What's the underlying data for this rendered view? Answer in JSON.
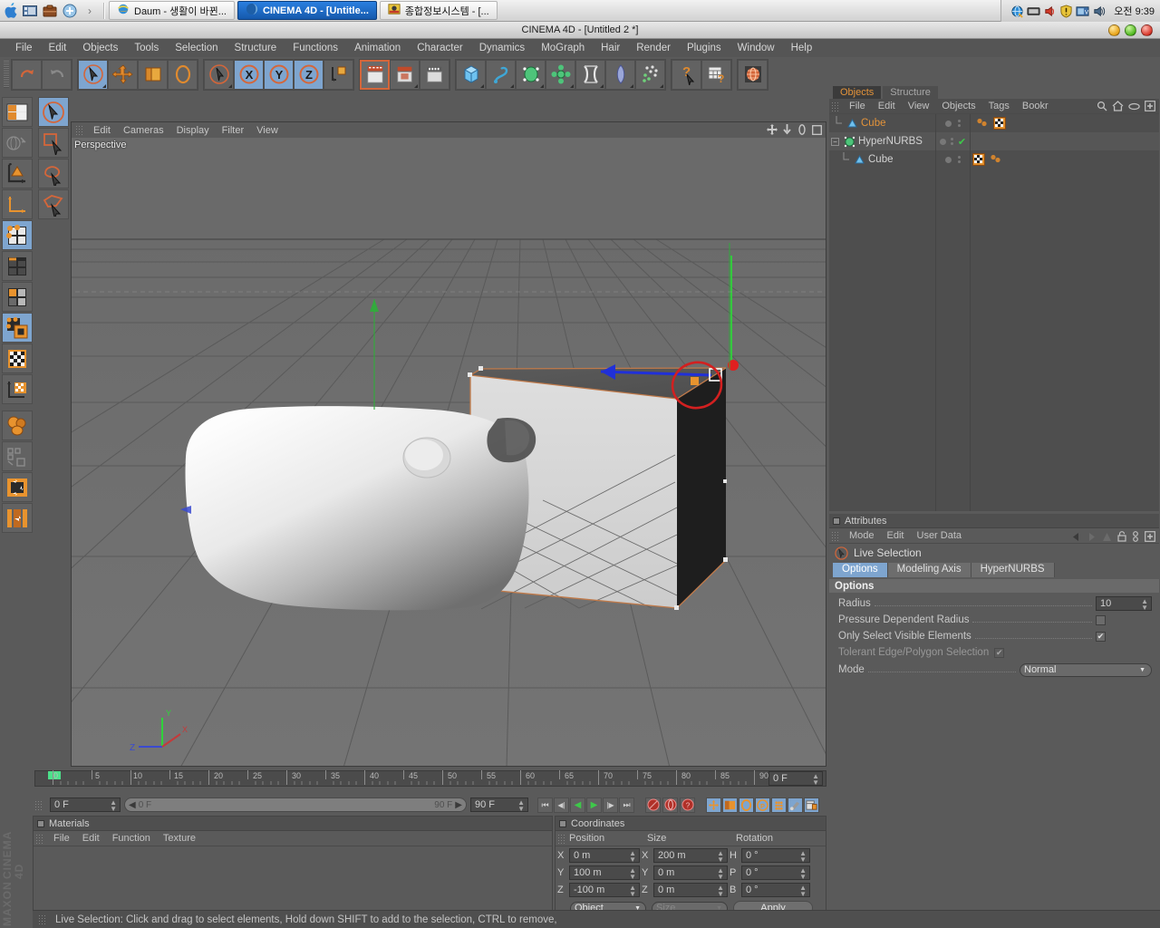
{
  "taskbar": {
    "quick_icons": [
      "apple-logo-icon",
      "media-player-icon",
      "briefcase-icon",
      "add-circle-icon",
      "chevron-right-icon"
    ],
    "tasks": [
      {
        "label": "Daum - 생활이 바뀐...",
        "icon": "ie-browser-icon",
        "active": false
      },
      {
        "label": "CINEMA 4D - [Untitle...",
        "icon": "cinema4d-icon",
        "active": true
      },
      {
        "label": "종합정보시스템 - [...",
        "icon": "shield-app-icon",
        "active": false
      }
    ],
    "tray_icons": [
      "network-globe-icon",
      "monitor-icon",
      "volume-red-icon",
      "shield-warning-icon",
      "tv-icon",
      "volume-icon"
    ],
    "clock": "오전 9:39"
  },
  "window": {
    "title": "CINEMA 4D - [Untitled 2 *]",
    "buttons": [
      "minimize",
      "maximize",
      "close"
    ]
  },
  "menubar": {
    "items": [
      "File",
      "Edit",
      "Objects",
      "Tools",
      "Selection",
      "Structure",
      "Functions",
      "Animation",
      "Character",
      "Dynamics",
      "MoGraph",
      "Hair",
      "Render",
      "Plugins",
      "Window",
      "Help"
    ]
  },
  "toolbar": {
    "groups": [
      {
        "buttons": [
          {
            "name": "undo-button",
            "glyph": "↶",
            "color": "#d4663a",
            "state": "normal"
          },
          {
            "name": "redo-button",
            "glyph": "↷",
            "color": "#8a8a8a",
            "state": "disabled"
          }
        ]
      },
      {
        "buttons": [
          {
            "name": "live-selection-button",
            "glyph": "selection-cursor-icon",
            "color": "#d4663a",
            "state": "active"
          },
          {
            "name": "move-button",
            "glyph": "move-arrows-icon",
            "color": "#e08a2e",
            "state": "normal"
          },
          {
            "name": "scale-button",
            "glyph": "scale-icon",
            "color": "#e08a2e",
            "state": "normal"
          },
          {
            "name": "rotate-button",
            "glyph": "rotate-icon",
            "color": "#e08a2e",
            "state": "normal"
          }
        ]
      },
      {
        "buttons": [
          {
            "name": "cursor-tool-button",
            "glyph": "cursor-circle-icon",
            "color": "#d4663a",
            "state": "normal"
          },
          {
            "name": "axis-x-button",
            "glyph": "X",
            "color": "#d4663a",
            "state": "active"
          },
          {
            "name": "axis-y-button",
            "glyph": "Y",
            "color": "#d4663a",
            "state": "active"
          },
          {
            "name": "axis-z-button",
            "glyph": "Z",
            "color": "#d4663a",
            "state": "active"
          },
          {
            "name": "world-object-coord-button",
            "glyph": "world-axis-icon",
            "color": "#e08a2e",
            "state": "normal"
          }
        ]
      },
      {
        "buttons": [
          {
            "name": "render-view-button",
            "glyph": "clapper-icon",
            "color": "#e0e0e0",
            "state": "highlight"
          },
          {
            "name": "render-region-button",
            "glyph": "clapper-region-icon",
            "color": "#e0e0e0",
            "state": "normal"
          },
          {
            "name": "render-settings-button",
            "glyph": "clapper-settings-icon",
            "color": "#e0e0e0",
            "state": "normal"
          }
        ]
      },
      {
        "buttons": [
          {
            "name": "add-cube-button",
            "glyph": "cube-icon",
            "color": "#5ab2e8",
            "state": "normal"
          },
          {
            "name": "add-spline-button",
            "glyph": "spline-icon",
            "color": "#3fa7d6",
            "state": "normal"
          },
          {
            "name": "add-nurbs-button",
            "glyph": "nurbs-icon",
            "color": "#3fbf6a",
            "state": "normal"
          },
          {
            "name": "add-modeling-object-button",
            "glyph": "array-icon",
            "color": "#3fbf6a",
            "state": "normal"
          },
          {
            "name": "add-deformer-button",
            "glyph": "deformer-icon",
            "color": "#dcdcdc",
            "state": "normal"
          },
          {
            "name": "add-scene-button",
            "glyph": "environment-icon",
            "color": "#9aa6d8",
            "state": "normal"
          },
          {
            "name": "add-particles-button",
            "glyph": "particles-icon",
            "color": "#6fd07a",
            "state": "normal"
          }
        ]
      },
      {
        "buttons": [
          {
            "name": "help-cursor-button",
            "glyph": "question-cursor-icon",
            "color": "#e08a2e",
            "state": "normal"
          },
          {
            "name": "content-browser-button",
            "glyph": "browser-question-icon",
            "color": "#dcdcdc",
            "state": "normal"
          }
        ]
      },
      {
        "buttons": [
          {
            "name": "web-button",
            "glyph": "globe-icon",
            "color": "#d4663a",
            "state": "normal"
          }
        ]
      }
    ]
  },
  "left_toolbar": {
    "column1": [
      {
        "name": "layout-presets-button",
        "glyph": "layout-grid-icon",
        "state": "normal"
      },
      {
        "name": "undo-view-button",
        "glyph": "globe-arrow-icon",
        "state": "disabled"
      },
      {
        "name": "make-editable-button",
        "glyph": "make-editable-icon",
        "state": "normal"
      },
      {
        "name": "model-axis-button",
        "glyph": "axis-icon",
        "state": "normal"
      },
      {
        "name": "point-mode-button",
        "glyph": "point-mode-icon",
        "state": "active"
      },
      {
        "name": "edge-mode-button",
        "glyph": "edge-mode-icon",
        "state": "normal"
      },
      {
        "name": "polygon-mode-button",
        "glyph": "polygon-mode-icon",
        "state": "normal"
      },
      {
        "name": "model-mode-button",
        "glyph": "model-mode-icon",
        "state": "active"
      },
      {
        "name": "texture-mode-button",
        "glyph": "texture-checker-icon",
        "state": "normal"
      },
      {
        "name": "texture-axis-button",
        "glyph": "texture-axis-icon",
        "state": "normal"
      },
      {
        "name": "object-axis-button",
        "glyph": "object-cubes-icon",
        "state": "normal"
      },
      {
        "name": "viewport-solo-button",
        "glyph": "viewport-solo-icon",
        "state": "normal"
      },
      {
        "name": "enable-axis-button",
        "glyph": "enable-axis-icon",
        "state": "normal"
      },
      {
        "name": "mirror-button",
        "glyph": "mirror-icon",
        "state": "normal"
      }
    ],
    "column2": [
      {
        "name": "live-selection-tool-button",
        "glyph": "live-selection-icon",
        "state": "active"
      },
      {
        "name": "rectangle-selection-button",
        "glyph": "rect-selection-icon",
        "state": "normal"
      },
      {
        "name": "lasso-selection-button",
        "glyph": "lasso-selection-icon",
        "state": "normal"
      },
      {
        "name": "polygon-selection-button",
        "glyph": "poly-selection-icon",
        "state": "normal"
      }
    ]
  },
  "viewport": {
    "menu": [
      "Edit",
      "Cameras",
      "Display",
      "Filter",
      "View"
    ],
    "label": "Perspective",
    "corner_icons": [
      "pan-icon",
      "dolly-icon",
      "rotate-view-icon",
      "maximize-view-icon"
    ],
    "axis_gizmo": {
      "x": "X",
      "y": "Y",
      "z": "Z"
    }
  },
  "timeline": {
    "ticks": [
      "0",
      "5",
      "10",
      "15",
      "20",
      "25",
      "30",
      "35",
      "40",
      "45",
      "50",
      "55",
      "60",
      "65",
      "70",
      "75",
      "80",
      "85",
      "90"
    ],
    "current_frame_field": "0 F",
    "range_start": "0 F",
    "range_end": "90 F",
    "end_frame_field": "90 F",
    "max_frame_field": "0 F",
    "playback_buttons": [
      {
        "name": "goto-start-button",
        "glyph": "⏮"
      },
      {
        "name": "step-back-button",
        "glyph": "◀|"
      },
      {
        "name": "play-reverse-button",
        "glyph": "◀"
      },
      {
        "name": "play-button",
        "glyph": "▶"
      },
      {
        "name": "step-forward-button",
        "glyph": "|▶"
      },
      {
        "name": "goto-end-button",
        "glyph": "⏭"
      }
    ],
    "record_buttons": [
      {
        "name": "record-keyframe-button",
        "glyph": "record-icon"
      },
      {
        "name": "autokey-button",
        "glyph": "autokey-icon"
      },
      {
        "name": "keyframe-selection-button",
        "glyph": "key-question-icon"
      }
    ],
    "key_toggle_buttons": [
      {
        "name": "position-key-button",
        "glyph": "move-key-icon",
        "state": "active"
      },
      {
        "name": "scale-key-button",
        "glyph": "scale-key-icon",
        "state": "active"
      },
      {
        "name": "rotation-key-button",
        "glyph": "rotation-key-icon",
        "state": "active"
      },
      {
        "name": "parameter-key-button",
        "glyph": "param-key-icon",
        "state": "active"
      },
      {
        "name": "pla-key-button",
        "glyph": "pla-key-icon",
        "state": "active"
      },
      {
        "name": "autokey-toggle-button",
        "glyph": "autokey-toggle-icon",
        "state": "active"
      },
      {
        "name": "keyframe-mode-button",
        "glyph": "keyframe-mode-icon",
        "state": "active"
      }
    ]
  },
  "materials": {
    "title": "Materials",
    "menu": [
      "File",
      "Edit",
      "Function",
      "Texture"
    ]
  },
  "coordinates": {
    "title": "Coordinates",
    "headers": [
      "Position",
      "Size",
      "Rotation"
    ],
    "rows": [
      {
        "pos_axis": "X",
        "pos_value": "0 m",
        "size_axis": "X",
        "size_value": "200 m",
        "rot_axis": "H",
        "rot_value": "0 °"
      },
      {
        "pos_axis": "Y",
        "pos_value": "100 m",
        "size_axis": "Y",
        "size_value": "0 m",
        "rot_axis": "P",
        "rot_value": "0 °"
      },
      {
        "pos_axis": "Z",
        "pos_value": "-100 m",
        "size_axis": "Z",
        "size_value": "0 m",
        "rot_axis": "B",
        "rot_value": "0 °"
      }
    ],
    "mode_select": "Object",
    "size_select": "Size",
    "apply_button": "Apply"
  },
  "object_manager": {
    "tabs": [
      {
        "label": "Objects",
        "active": true
      },
      {
        "label": "Structure",
        "active": false
      }
    ],
    "menu": [
      "File",
      "Edit",
      "View",
      "Objects",
      "Tags",
      "Bookr"
    ],
    "header_icons": [
      "search-icon",
      "home-icon",
      "eye-icon",
      "plus-box-icon"
    ],
    "items": [
      {
        "label": "Cube",
        "icon": "polygon-object-icon",
        "indent": 1,
        "selected": true,
        "expander": "",
        "tags": [
          "material-tag-icon",
          "checker-tag-icon"
        ],
        "visible_dots": 2,
        "check": false
      },
      {
        "label": "HyperNURBS",
        "icon": "hypernurbs-icon",
        "indent": 0,
        "selected": false,
        "expander": "−",
        "tags": [],
        "visible_dots": 2,
        "check": true
      },
      {
        "label": "Cube",
        "icon": "polygon-object-icon",
        "indent": 1,
        "selected": false,
        "expander": "",
        "tags": [
          "checker-tag-icon",
          "material-tag-icon"
        ],
        "visible_dots": 2,
        "check": false
      }
    ]
  },
  "attributes": {
    "title": "Attributes",
    "menu": [
      "Mode",
      "Edit",
      "User Data"
    ],
    "header_icons": [
      "back-arrow-icon",
      "forward-arrow-icon",
      "up-arrow-icon",
      "lock-icon",
      "link-icon",
      "plus-box-icon"
    ],
    "object_name": "Live Selection",
    "object_icon": "live-selection-icon",
    "tabs": [
      {
        "label": "Options",
        "active": true
      },
      {
        "label": "Modeling Axis",
        "active": false
      },
      {
        "label": "HyperNURBS",
        "active": false
      }
    ],
    "section_title": "Options",
    "fields": [
      {
        "label": "Radius",
        "type": "number",
        "value": "10",
        "disabled": false
      },
      {
        "label": "Pressure Dependent Radius",
        "type": "checkbox",
        "value": "",
        "disabled": false
      },
      {
        "label": "Only Select Visible Elements",
        "type": "checkbox",
        "value": "✔",
        "disabled": false
      },
      {
        "label": "Tolerant Edge/Polygon Selection",
        "type": "checkbox",
        "value": "✔",
        "disabled": true
      },
      {
        "label": "Mode",
        "type": "select",
        "value": "Normal",
        "disabled": false
      }
    ]
  },
  "status_bar": {
    "text": "Live Selection: Click and drag to select elements, Hold down SHIFT to add to the selection, CTRL to remove,"
  },
  "brand": {
    "line1": "MAXON",
    "line2": "CINEMA 4D"
  },
  "colors": {
    "accent_orange": "#e3933a",
    "active_blue": "#7ea5cf",
    "panel_bg": "#5a5a5a",
    "tree_bg": "#4e4e4e",
    "viewport_bg": "#6e6e6e",
    "annotation_red": "#d22020",
    "axis_green": "#29c42c",
    "axis_blue": "#2a36d0",
    "axis_red": "#c42a2a"
  }
}
